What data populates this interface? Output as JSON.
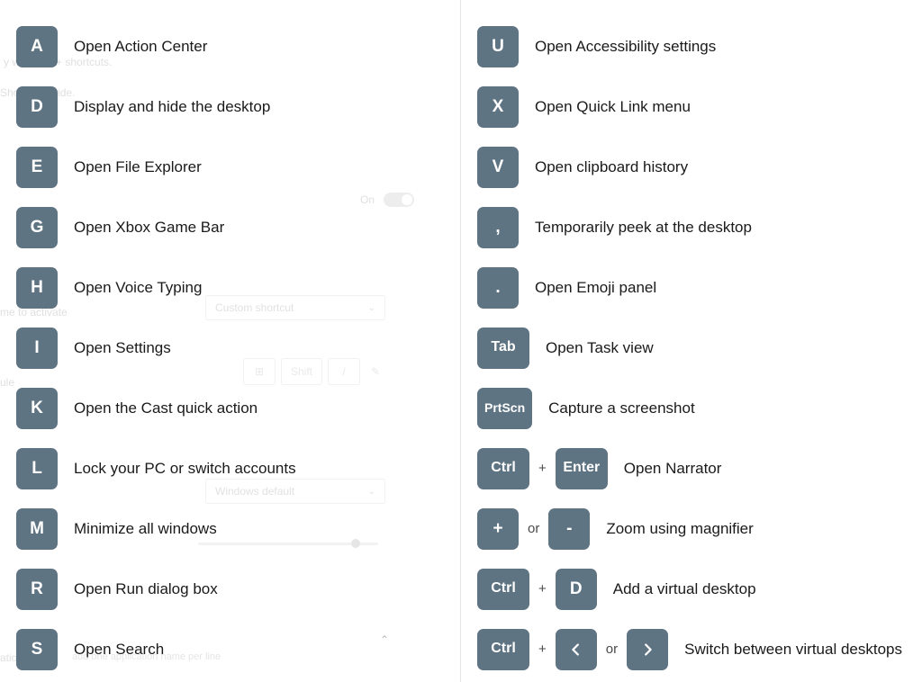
{
  "colors": {
    "key_bg": "#5f7483",
    "key_fg": "#ffffff",
    "text": "#1a1a1a",
    "faint": "#b9b9b9"
  },
  "underlay": {
    "line1": "y with Win + shortcuts.",
    "line2": "Shortcut Guide.",
    "toggle_label": "On",
    "line3": "me to activate",
    "dropdown1": "Custom shortcut",
    "combo_key2": "Shift",
    "line4": "ule",
    "dropdown2": "Windows default",
    "line5": "ations",
    "excluded_hint": "add one application name per line"
  },
  "left": [
    {
      "keys": [
        "A"
      ],
      "desc": "Open Action Center"
    },
    {
      "keys": [
        "D"
      ],
      "desc": "Display and hide the desktop"
    },
    {
      "keys": [
        "E"
      ],
      "desc": "Open File Explorer"
    },
    {
      "keys": [
        "G"
      ],
      "desc": "Open Xbox Game Bar"
    },
    {
      "keys": [
        "H"
      ],
      "desc": "Open Voice Typing"
    },
    {
      "keys": [
        "I"
      ],
      "desc": "Open Settings"
    },
    {
      "keys": [
        "K"
      ],
      "desc": "Open the Cast quick action"
    },
    {
      "keys": [
        "L"
      ],
      "desc": "Lock your PC or switch accounts"
    },
    {
      "keys": [
        "M"
      ],
      "desc": "Minimize all windows"
    },
    {
      "keys": [
        "R"
      ],
      "desc": "Open Run dialog box"
    },
    {
      "keys": [
        "S"
      ],
      "desc": "Open Search"
    }
  ],
  "right": [
    {
      "keys": [
        "U"
      ],
      "desc": "Open Accessibility settings"
    },
    {
      "keys": [
        "X"
      ],
      "desc": "Open Quick Link menu"
    },
    {
      "keys": [
        "V"
      ],
      "desc": "Open clipboard history"
    },
    {
      "keys": [
        ","
      ],
      "desc": "Temporarily peek at the desktop"
    },
    {
      "keys": [
        "."
      ],
      "desc": "Open Emoji panel"
    },
    {
      "keys": [
        "Tab"
      ],
      "wide": [
        0
      ],
      "desc": "Open Task view"
    },
    {
      "keys": [
        "Prt\nScn"
      ],
      "multi": [
        0
      ],
      "desc": "Capture a screenshot"
    },
    {
      "keys": [
        "Ctrl",
        "Enter"
      ],
      "wide": [
        0,
        1
      ],
      "seps": [
        "+"
      ],
      "desc": "Open Narrator"
    },
    {
      "keys": [
        "+",
        "-"
      ],
      "seps": [
        "or"
      ],
      "desc": "Zoom using magnifier"
    },
    {
      "keys": [
        "Ctrl",
        "D"
      ],
      "wide": [
        0
      ],
      "seps": [
        "+"
      ],
      "desc": "Add a virtual desktop"
    },
    {
      "keys": [
        "Ctrl",
        "<chev-left>",
        "<chev-right>"
      ],
      "wide": [
        0
      ],
      "seps": [
        "+",
        "or"
      ],
      "desc": "Switch between virtual desktops"
    }
  ]
}
